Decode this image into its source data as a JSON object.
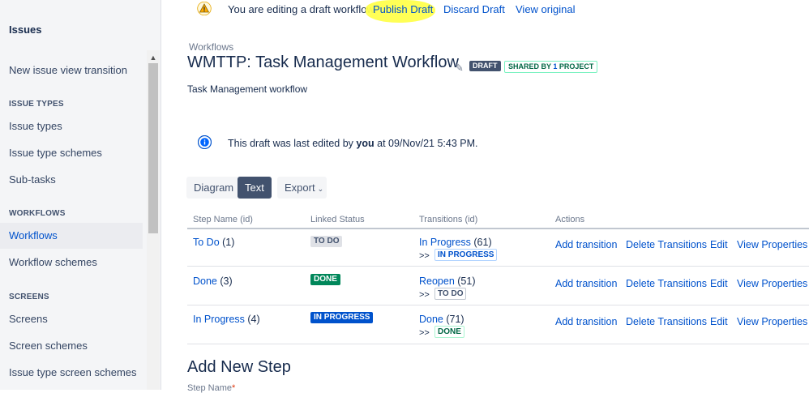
{
  "sidebar": {
    "title": "Issues",
    "items": [
      {
        "label": "New issue view transition"
      },
      {
        "label": "Issue types"
      },
      {
        "label": "Issue type schemes"
      },
      {
        "label": "Sub-tasks"
      },
      {
        "label": "Workflows"
      },
      {
        "label": "Workflow schemes"
      },
      {
        "label": "Screens"
      },
      {
        "label": "Screen schemes"
      },
      {
        "label": "Issue type screen schemes"
      }
    ],
    "headings": {
      "issue_types": "ISSUE TYPES",
      "workflows": "WORKFLOWS",
      "screens": "SCREENS"
    }
  },
  "banner": {
    "message": "You are editing a draft workflow.",
    "publish": "Publish Draft",
    "discard": "Discard Draft",
    "view_original": "View original"
  },
  "header": {
    "breadcrumb": "Workflows",
    "title": "WMTTP: Task Management Workflow",
    "draft_lozenge": "DRAFT",
    "shared_prefix": "SHARED BY ",
    "shared_count": "1",
    "shared_suffix": " PROJECT",
    "description": "Task Management workflow"
  },
  "info": {
    "prefix": "This draft was last edited by ",
    "user": "you",
    "suffix": " at 09/Nov/21 5:43 PM."
  },
  "view_tabs": {
    "diagram": "Diagram",
    "text": "Text",
    "export": "Export"
  },
  "table": {
    "headers": [
      "Step Name (id)",
      "Linked Status",
      "Transitions (id)",
      "Actions"
    ],
    "rows": [
      {
        "step_name": "To Do",
        "step_id": " (1)",
        "status": "TO DO",
        "transition": "In Progress",
        "transition_id": " (61)",
        "target": "IN PROGRESS"
      },
      {
        "step_name": "Done",
        "step_id": " (3)",
        "status": "DONE",
        "transition": "Reopen",
        "transition_id": " (51)",
        "target": "TO DO"
      },
      {
        "step_name": "In Progress",
        "step_id": " (4)",
        "status": "IN PROGRESS",
        "transition": "Done",
        "transition_id": " (71)",
        "target": "DONE"
      }
    ],
    "arrow": ">>",
    "actions": {
      "add": "Add transition",
      "delete": "Delete Transitions",
      "edit": "Edit",
      "view": "View Properties"
    }
  },
  "add_step": {
    "title": "Add New Step",
    "field_label": "Step Name",
    "required_mark": "*"
  },
  "colors": {
    "accent": "#0052cc",
    "highlight": "#ffff4d",
    "done_green": "#00875a"
  },
  "icons": {
    "banner": "warning-icon",
    "info": "info-icon",
    "edit": "pencil-icon",
    "dropdown": "chevron-down-icon"
  }
}
